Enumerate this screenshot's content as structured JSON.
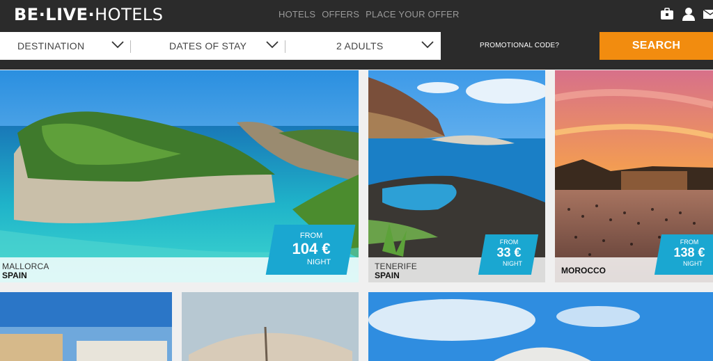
{
  "brand": {
    "logo_left": "BE·LIVE·",
    "logo_right": "HOTELS"
  },
  "nav": [
    "HOTELS",
    "OFFERS",
    "PLACE YOUR OFFER"
  ],
  "header_icons": [
    "suitcase-icon",
    "user-icon",
    "mail-icon"
  ],
  "search": {
    "destination": "DESTINATION",
    "dates": "DATES OF STAY",
    "guests": "2 ADULTS",
    "promo": "PROMOTIONAL CODE?",
    "button": "SEARCH"
  },
  "colors": {
    "accent": "#f28c0f",
    "price_badge": "#1aa7d1",
    "header": "#2b2b2b"
  },
  "cards": [
    {
      "city": "MALLORCA",
      "country": "SPAIN",
      "price": {
        "from": "FROM",
        "amount": "104 €",
        "unit": "NIGHT"
      }
    },
    {
      "city": "TENERIFE",
      "country": "SPAIN",
      "price": {
        "from": "FROM",
        "amount": "33 €",
        "unit": "NIGHT"
      }
    },
    {
      "city": "",
      "country": "MOROCCO",
      "price": {
        "from": "FROM",
        "amount": "138 €",
        "unit": "NIGHT"
      }
    }
  ]
}
